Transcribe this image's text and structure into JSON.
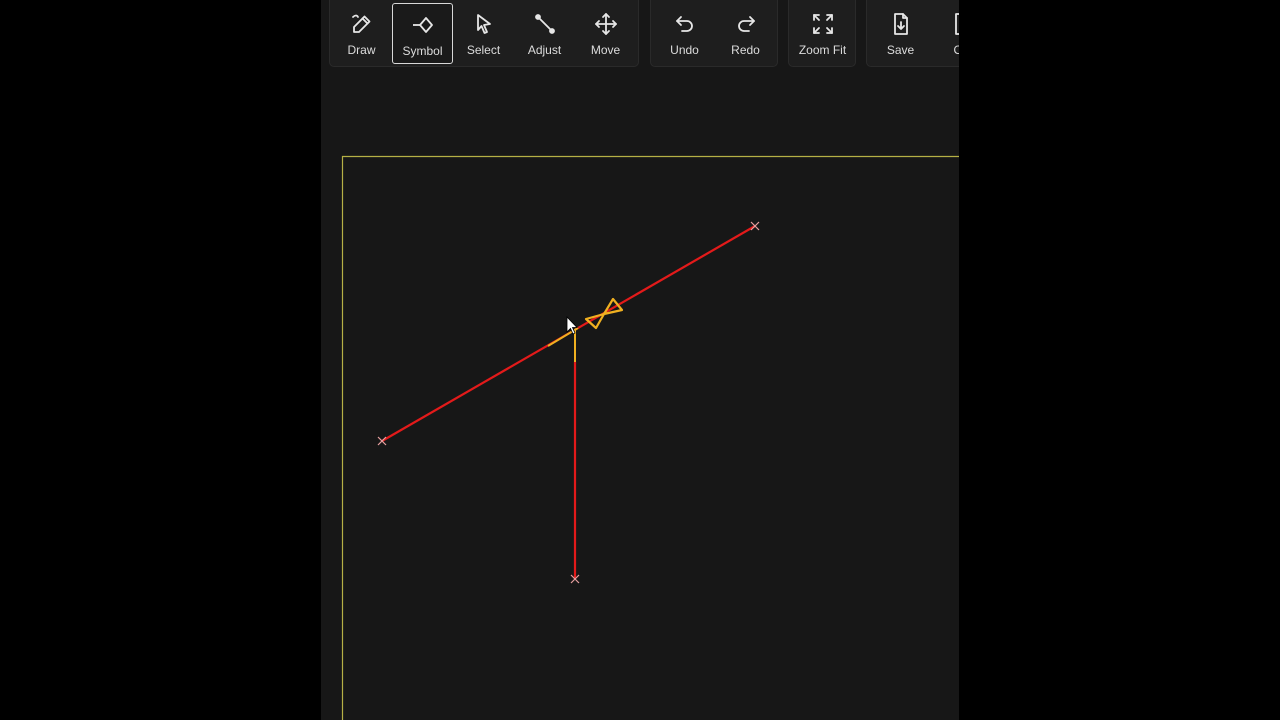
{
  "toolbar": {
    "groups": [
      {
        "name": "edit-tools",
        "buttons": [
          {
            "id": "draw",
            "label": "Draw",
            "icon": "pencil-icon",
            "active": false
          },
          {
            "id": "symbol",
            "label": "Symbol",
            "icon": "symbol-diamond-icon",
            "active": true
          },
          {
            "id": "select",
            "label": "Select",
            "icon": "cursor-arrow-icon",
            "active": false
          },
          {
            "id": "adjust",
            "label": "Adjust",
            "icon": "adjust-line-icon",
            "active": false
          },
          {
            "id": "move",
            "label": "Move",
            "icon": "move-arrows-icon",
            "active": false
          }
        ]
      },
      {
        "name": "history-tools",
        "buttons": [
          {
            "id": "undo",
            "label": "Undo",
            "icon": "undo-icon",
            "active": false
          },
          {
            "id": "redo",
            "label": "Redo",
            "icon": "redo-icon",
            "active": false
          }
        ]
      },
      {
        "name": "view-tools",
        "buttons": [
          {
            "id": "zoom-fit",
            "label": "Zoom Fit",
            "icon": "zoom-fit-icon",
            "active": false
          }
        ]
      },
      {
        "name": "file-tools",
        "buttons": [
          {
            "id": "save",
            "label": "Save",
            "icon": "save-file-icon",
            "active": false
          },
          {
            "id": "open",
            "label": "Op",
            "icon": "open-file-icon",
            "active": false
          }
        ]
      }
    ]
  },
  "canvas": {
    "background": "#171717",
    "frame_color": "#b5b045",
    "line_color": "#e31a1a",
    "symbol_color": "#f0b020",
    "endpoint_color": "#e8a0a0",
    "cursor_icon": "mouse-pointer-icon"
  }
}
